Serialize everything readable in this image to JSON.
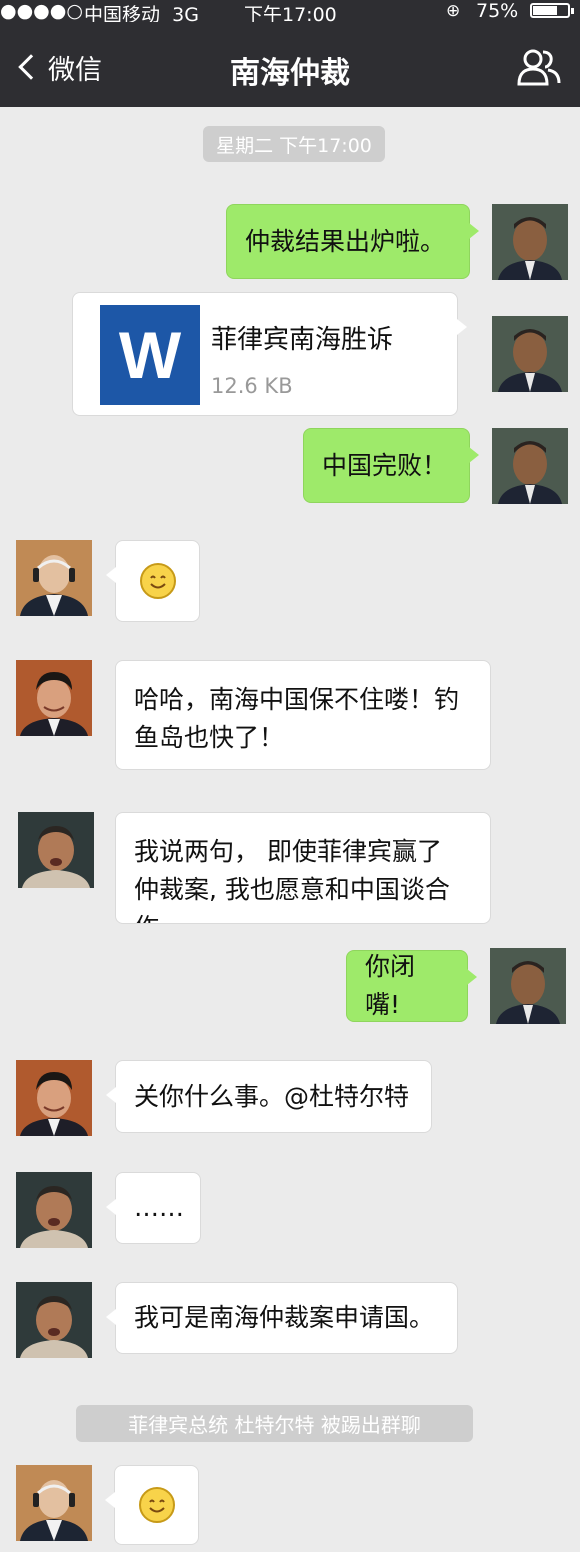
{
  "status_bar": {
    "signal": "●●●●○",
    "carrier": "中国移动",
    "network": "3G",
    "time": "下午17:00",
    "battery": "75%",
    "battery_level": 0.75
  },
  "nav": {
    "back_label": "微信",
    "title": "南海仲裁",
    "contacts_icon": "group-contacts-icon"
  },
  "timestamp": "星期二 下午17:00",
  "messages": [
    {
      "side": "right",
      "type": "text",
      "text": "仲裁结果出炉啦。"
    },
    {
      "side": "right",
      "type": "file",
      "file_icon": "W",
      "file_name": "菲律宾南海胜诉",
      "file_size": "12.6 KB"
    },
    {
      "side": "right",
      "type": "text",
      "text": "中国完败！"
    },
    {
      "side": "left",
      "type": "emoji",
      "emoji": "smile-emoji"
    },
    {
      "side": "left",
      "type": "text",
      "lines": [
        "哈哈，南海中国保不住喽！钓",
        "鱼岛也快了！"
      ]
    },
    {
      "side": "left",
      "type": "text",
      "lines": [
        "我说两句， 即使菲律宾赢了",
        "仲裁案, 我也愿意和中国谈合",
        "作……"
      ]
    },
    {
      "side": "right",
      "type": "text",
      "text": "你闭嘴!"
    },
    {
      "side": "left",
      "type": "text",
      "text": "关你什么事。@杜特尔特"
    },
    {
      "side": "left",
      "type": "text",
      "text": "……"
    },
    {
      "side": "left",
      "type": "text",
      "text": "我可是南海仲裁案申请国。"
    },
    {
      "side": "left",
      "type": "emoji",
      "emoji": "smile-emoji"
    }
  ],
  "system_notice": "菲律宾总统  杜特尔特  被踢出群聊",
  "colors": {
    "nav_bg": "#2e2e32",
    "chat_bg": "#ebebeb",
    "bubble_self": "#9eea6a",
    "bubble_other": "#ffffff",
    "file_icon_bg": "#1d57a7"
  }
}
